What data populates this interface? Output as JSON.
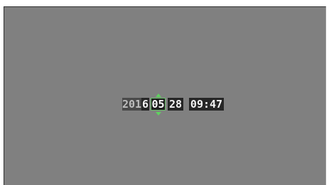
{
  "clock": {
    "year_prefix": "201",
    "year_last_digit": "6",
    "month": "05",
    "day": "28",
    "time": "09:47",
    "selected_field": "month"
  },
  "colors": {
    "background": "#808080",
    "segment": "#262626",
    "accent_arrows": "#5fd35f"
  },
  "icons": {
    "up": "triangle-up",
    "down": "triangle-down"
  }
}
